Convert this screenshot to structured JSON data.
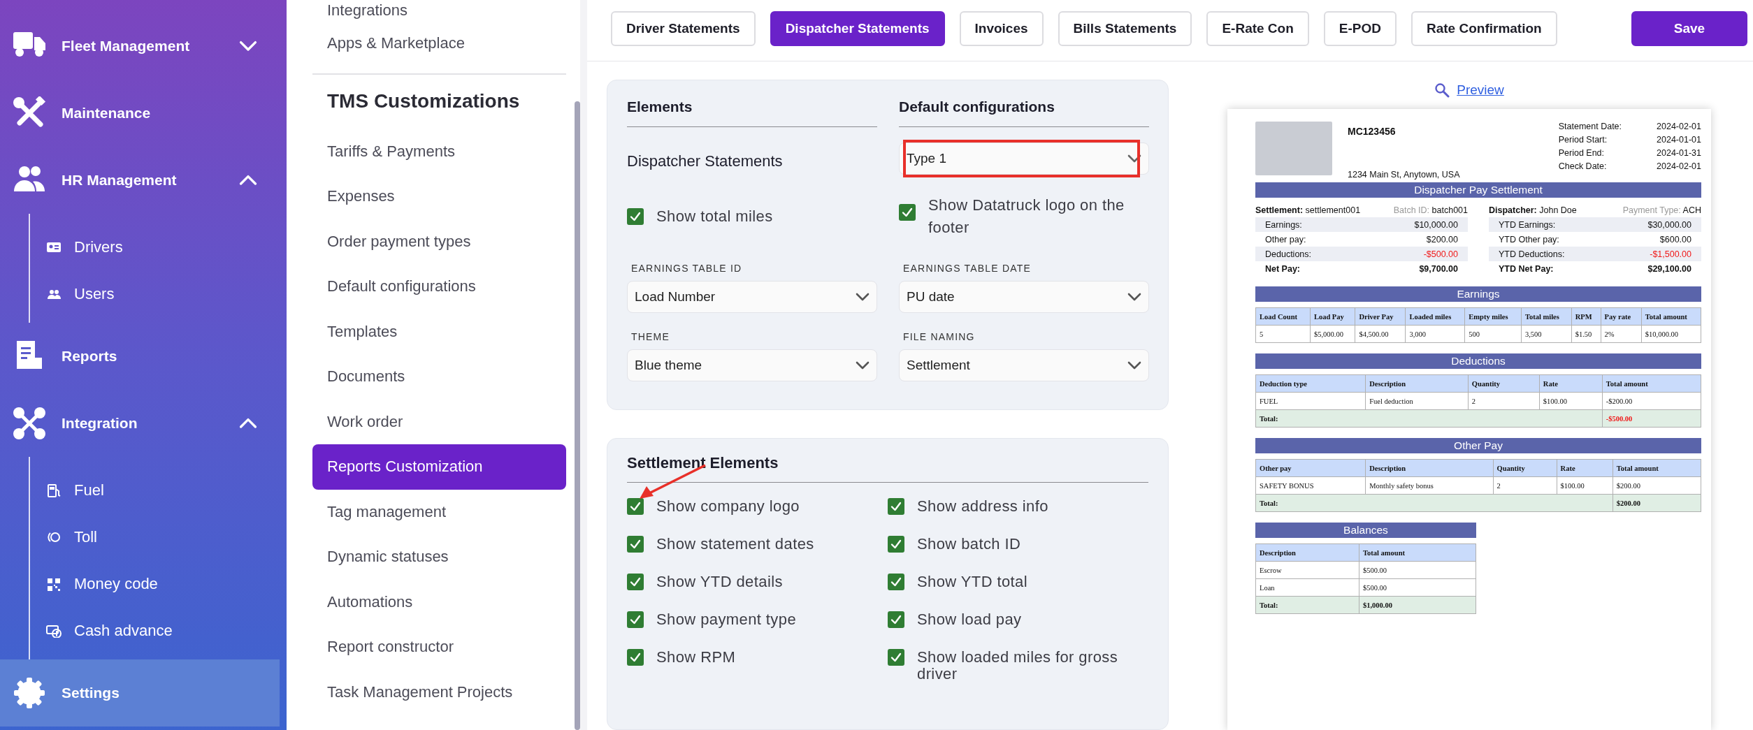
{
  "sidebar": {
    "items": [
      {
        "label": "Fleet Management",
        "expanded": false,
        "selected": false
      },
      {
        "label": "Maintenance",
        "selected": false
      },
      {
        "label": "HR Management",
        "expanded": true,
        "selected": false,
        "children": [
          {
            "label": "Drivers",
            "selected": false
          },
          {
            "label": "Users",
            "selected": false
          }
        ]
      },
      {
        "label": "Reports",
        "selected": false
      },
      {
        "label": "Integration",
        "expanded": true,
        "selected": false,
        "children": [
          {
            "label": "Fuel",
            "selected": false
          },
          {
            "label": "Toll",
            "selected": false
          },
          {
            "label": "Money code",
            "selected": false
          },
          {
            "label": "Cash advance",
            "selected": false
          }
        ]
      },
      {
        "label": "Settings",
        "selected": true
      }
    ]
  },
  "settings_menu": {
    "items": [
      {
        "label": "Integrations",
        "selected": false
      },
      {
        "label": "Apps & Marketplace",
        "selected": false
      }
    ],
    "section_title": "TMS Customizations",
    "section_items": [
      {
        "label": "Tariffs & Payments",
        "selected": false
      },
      {
        "label": "Expenses",
        "selected": false
      },
      {
        "label": "Order payment types",
        "selected": false
      },
      {
        "label": "Default configurations",
        "selected": false
      },
      {
        "label": "Templates",
        "selected": false
      },
      {
        "label": "Documents",
        "selected": false
      },
      {
        "label": "Work order",
        "selected": false
      },
      {
        "label": "Reports Customization",
        "selected": true
      },
      {
        "label": "Tag management",
        "selected": false
      },
      {
        "label": "Dynamic statuses",
        "selected": false
      },
      {
        "label": "Automations",
        "selected": false
      },
      {
        "label": "Report constructor",
        "selected": false
      },
      {
        "label": "Task Management Projects",
        "selected": false
      }
    ]
  },
  "tabs": [
    {
      "label": "Driver Statements",
      "selected": false
    },
    {
      "label": "Dispatcher Statements",
      "selected": true
    },
    {
      "label": "Invoices",
      "selected": false
    },
    {
      "label": "Bills Statements",
      "selected": false
    },
    {
      "label": "E-Rate Con",
      "selected": false
    },
    {
      "label": "E-POD",
      "selected": false
    },
    {
      "label": "Rate Confirmation",
      "selected": false
    }
  ],
  "save_button": "Save",
  "config_panel": {
    "headers": [
      "Elements",
      "Default configurations"
    ],
    "element": {
      "label": "Dispatcher Statements",
      "value": "Type 1",
      "annotated": true
    },
    "checkboxes": [
      {
        "label": "Show total miles",
        "checked": true
      },
      {
        "label": "Show Datatruck logo on the footer",
        "checked": true
      }
    ],
    "selects": [
      {
        "label": "EARNINGS TABLE ID",
        "value": "Load Number"
      },
      {
        "label": "EARNINGS TABLE DATE",
        "value": "PU date"
      },
      {
        "label": "THEME",
        "value": "Blue theme"
      },
      {
        "label": "FILE NAMING",
        "value": "Settlement"
      }
    ]
  },
  "settlement_elements": {
    "title": "Settlement Elements",
    "items": [
      {
        "label": "Show company logo",
        "checked": true,
        "annotated": true
      },
      {
        "label": "Show address info",
        "checked": true
      },
      {
        "label": "Show statement dates",
        "checked": true
      },
      {
        "label": "Show batch ID",
        "checked": true
      },
      {
        "label": "Show YTD details",
        "checked": true
      },
      {
        "label": "Show YTD total",
        "checked": true
      },
      {
        "label": "Show payment type",
        "checked": true
      },
      {
        "label": "Show load pay",
        "checked": true
      },
      {
        "label": "Show RPM",
        "checked": true
      },
      {
        "label": "Show loaded miles for gross driver",
        "checked": true
      }
    ]
  },
  "preview": {
    "link": "Preview",
    "company": "MC123456",
    "address": "1234 Main St, Anytown, USA",
    "dates": [
      {
        "label": "Statement Date:",
        "value": "2024-02-01"
      },
      {
        "label": "Period Start:",
        "value": "2024-01-01"
      },
      {
        "label": "Period End:",
        "value": "2024-01-31"
      },
      {
        "label": "Check Date:",
        "value": "2024-02-01"
      }
    ],
    "title": "Dispatcher Pay Settlement",
    "info": [
      [
        {
          "label": "Settlement:",
          "value": "settlement001",
          "kind": "primary"
        },
        {
          "label": "Batch ID:",
          "value": "batch001",
          "kind": "secondary"
        }
      ],
      [
        {
          "label": "Dispatcher:",
          "value": "John Doe",
          "kind": "primary"
        },
        {
          "label": "Payment Type:",
          "value": "ACH",
          "kind": "secondary"
        }
      ]
    ],
    "summary": [
      [
        {
          "label": "Earnings:",
          "value": "$10,000.00",
          "negative": false,
          "kind": "line"
        },
        {
          "label": "Other pay:",
          "value": "$200.00",
          "negative": false,
          "kind": "line"
        },
        {
          "label": "Deductions:",
          "value": "-$500.00",
          "negative": true,
          "kind": "line"
        },
        {
          "label": "Net Pay:",
          "value": "$9,700.00",
          "negative": false,
          "kind": "total"
        }
      ],
      [
        {
          "label": "YTD Earnings:",
          "value": "$30,000.00",
          "negative": false,
          "kind": "line"
        },
        {
          "label": "YTD Other pay:",
          "value": "$600.00",
          "negative": false,
          "kind": "line"
        },
        {
          "label": "YTD Deductions:",
          "value": "-$1,500.00",
          "negative": true,
          "kind": "line"
        },
        {
          "label": "YTD Net Pay:",
          "value": "$29,100.00",
          "negative": false,
          "kind": "total"
        }
      ]
    ],
    "tables": [
      {
        "title": "Earnings",
        "columns": [
          "Load Count",
          "Load Pay",
          "Driver Pay",
          "Loaded miles",
          "Empty miles",
          "Total miles",
          "RPM",
          "Pay rate",
          "Total amount"
        ],
        "rows": [
          [
            "5",
            "$5,000.00",
            "$4,500.00",
            "3,000",
            "500",
            "3,500",
            "$1.50",
            "2%",
            "$10,000.00"
          ]
        ]
      },
      {
        "title": "Deductions",
        "columns": [
          "Deduction type",
          "Description",
          "Quantity",
          "Rate",
          "Total amount"
        ],
        "rows": [
          [
            "FUEL",
            "Fuel deduction",
            "2",
            "$100.00",
            "-$200.00"
          ]
        ],
        "total": {
          "label": "Total:",
          "value": "-$500.00",
          "negative": true
        }
      },
      {
        "title": "Other Pay",
        "columns": [
          "Other pay",
          "Description",
          "Quantity",
          "Rate",
          "Total amount"
        ],
        "rows": [
          [
            "SAFETY BONUS",
            "Monthly safety bonus",
            "2",
            "$100.00",
            "$200.00"
          ]
        ],
        "total": {
          "label": "Total:",
          "value": "$200.00",
          "negative": false
        }
      },
      {
        "title": "Balances",
        "columns": [
          "Description",
          "Total amount"
        ],
        "rows": [
          [
            "Escrow",
            "$500.00"
          ],
          [
            "Loan",
            "$500.00"
          ]
        ],
        "total": {
          "label": "Total:",
          "value": "$1,000.00",
          "negative": false
        }
      }
    ]
  }
}
